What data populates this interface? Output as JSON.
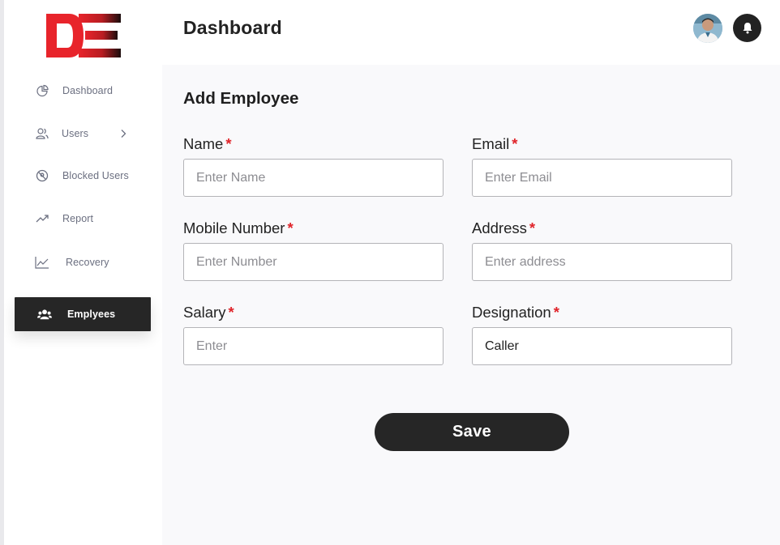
{
  "brand": {
    "logo_text": "DE",
    "logo_colors": {
      "primary": "#e8242b",
      "secondary": "#111111"
    }
  },
  "sidebar": {
    "items": [
      {
        "label": "Dashboard",
        "icon": "pie-chart-icon",
        "active": false
      },
      {
        "label": "Users",
        "icon": "users-icon",
        "active": false,
        "has_submenu": true
      },
      {
        "label": "Blocked Users",
        "icon": "blocked-icon",
        "active": false
      },
      {
        "label": "Report",
        "icon": "trending-up-icon",
        "active": false
      },
      {
        "label": "Recovery",
        "icon": "line-chart-icon",
        "active": false
      },
      {
        "label": "Emplyees",
        "icon": "group-icon",
        "active": true
      }
    ]
  },
  "header": {
    "title": "Dashboard",
    "avatar_icon": "user-avatar",
    "notification_icon": "bell-icon"
  },
  "form": {
    "title": "Add Employee",
    "required_marker": "*",
    "fields": {
      "name": {
        "label": "Name",
        "placeholder": "Enter Name",
        "value": ""
      },
      "email": {
        "label": "Email",
        "placeholder": "Enter Email",
        "value": ""
      },
      "mobile": {
        "label": "Mobile Number",
        "placeholder": "Enter Number",
        "value": ""
      },
      "address": {
        "label": "Address",
        "placeholder": "Enter address",
        "value": ""
      },
      "salary": {
        "label": "Salary",
        "placeholder": "Enter",
        "value": ""
      },
      "designation": {
        "label": "Designation",
        "placeholder": "",
        "value": "Caller"
      }
    },
    "save_label": "Save"
  },
  "colors": {
    "accent_dark": "#262626",
    "required_red": "#e0242a",
    "main_bg": "#f9f9fb"
  }
}
